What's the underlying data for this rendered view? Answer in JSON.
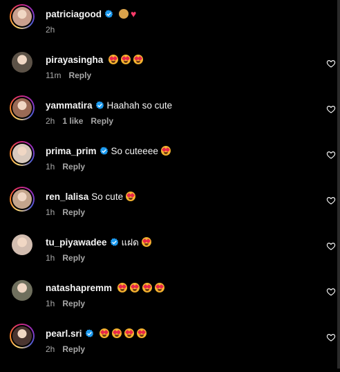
{
  "comments": [
    {
      "username": "patriciagood",
      "verified": true,
      "text": "",
      "emojis": [
        "cookie",
        "heart"
      ],
      "time": "2h",
      "likes": "",
      "reply_label": "",
      "avatar_color": "#c9a08e",
      "ring": true,
      "show_like_button": false
    },
    {
      "username": "pirayasingha",
      "verified": false,
      "text": "",
      "emojis": [
        "star-eyes",
        "star-eyes",
        "star-eyes"
      ],
      "time": "11m",
      "likes": "",
      "reply_label": "Reply",
      "avatar_color": "#5c5247",
      "ring": false,
      "show_like_button": true
    },
    {
      "username": "yammatira",
      "verified": true,
      "text": "Haahah so cute",
      "emojis": [],
      "time": "2h",
      "likes": "1 like",
      "reply_label": "Reply",
      "avatar_color": "#9a6a55",
      "ring": true,
      "show_like_button": true
    },
    {
      "username": "prima_prim",
      "verified": true,
      "text": "So cuteeee",
      "emojis": [
        "star-eyes"
      ],
      "time": "1h",
      "likes": "",
      "reply_label": "Reply",
      "avatar_color": "#d8c9bd",
      "ring": true,
      "show_like_button": true
    },
    {
      "username": "ren_lalisa",
      "verified": false,
      "text": "So cute",
      "emojis": [
        "star-eyes"
      ],
      "time": "1h",
      "likes": "",
      "reply_label": "Reply",
      "avatar_color": "#c4a58c",
      "ring": true,
      "show_like_button": true
    },
    {
      "username": "tu_piyawadee",
      "verified": true,
      "text": "แฝด",
      "emojis": [
        "star-eyes"
      ],
      "time": "1h",
      "likes": "",
      "reply_label": "Reply",
      "avatar_color": "#d2bdb0",
      "ring": false,
      "show_like_button": true
    },
    {
      "username": "natashapremm",
      "verified": false,
      "text": "",
      "emojis": [
        "star-eyes",
        "star-eyes",
        "star-eyes",
        "star-eyes"
      ],
      "time": "1h",
      "likes": "",
      "reply_label": "Reply",
      "avatar_color": "#6f6f5d",
      "ring": false,
      "show_like_button": true
    },
    {
      "username": "pearl.sri",
      "verified": true,
      "text": "",
      "emojis": [
        "star-eyes",
        "star-eyes",
        "star-eyes",
        "star-eyes"
      ],
      "time": "2h",
      "likes": "",
      "reply_label": "Reply",
      "avatar_color": "#4a3530",
      "ring": true,
      "show_like_button": true
    }
  ]
}
